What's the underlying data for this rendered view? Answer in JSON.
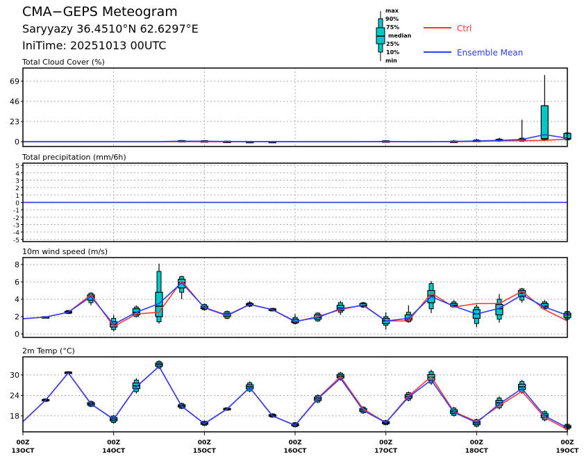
{
  "header": {
    "title": "CMA−GEPS Meteogram",
    "station": "Saryyazy 36.4510°N 62.6297°E",
    "init_time": "IniTime: 20251013 00UTC"
  },
  "legend": {
    "box_labels": [
      "max",
      "90%",
      "75%",
      "median",
      "25%",
      "10%",
      "min"
    ],
    "ctrl_label": "Ctrl",
    "mean_label": "Ensemble Mean"
  },
  "colors": {
    "ctrl": "#ff3333",
    "mean": "#2a3cff",
    "box": "#00c8c8",
    "grid": "#aaaaaa"
  },
  "chart_data": [
    {
      "type": "line",
      "title": "Total Cloud Cover (%)",
      "ylim": [
        -5.5,
        84
      ],
      "yticks": [
        0,
        23,
        46,
        69
      ],
      "x_steps_hours": 6,
      "ensemble_mean": [
        0,
        0,
        0,
        0,
        0,
        0,
        0,
        0.6,
        0.5,
        0.2,
        0.1,
        0.1,
        0,
        0,
        0,
        0,
        0.3,
        0,
        0,
        0.3,
        0.8,
        1.5,
        2.5,
        8,
        4
      ],
      "ctrl": [
        0,
        0,
        0,
        0,
        0,
        0,
        0,
        0,
        0,
        0,
        0,
        0,
        0,
        0,
        0,
        0,
        0,
        0,
        0,
        0,
        0.3,
        1,
        1.2,
        1.5,
        3
      ],
      "boxes": [
        null,
        null,
        null,
        null,
        null,
        null,
        null,
        [
          0,
          0.2,
          0.4,
          0.8,
          1.2,
          1.4,
          1.6
        ],
        [
          0,
          0.2,
          0.4,
          0.7,
          1.0,
          1.2,
          1.4
        ],
        [
          0,
          0.1,
          0.2,
          0.3,
          0.5,
          0.6,
          0.7
        ],
        [
          0,
          0,
          0.1,
          0.2,
          0.3,
          0.4,
          0.5
        ],
        [
          0,
          0,
          0.1,
          0.2,
          0.3,
          0.4,
          0.5
        ],
        null,
        null,
        null,
        null,
        [
          0,
          0.2,
          0.4,
          0.6,
          0.9,
          1.1,
          1.3
        ],
        null,
        null,
        [
          0,
          0,
          0.2,
          0.4,
          0.6,
          0.8,
          2
        ],
        [
          0,
          0.3,
          0.6,
          1,
          1.5,
          2,
          3
        ],
        [
          0,
          0.5,
          1,
          1.6,
          2.5,
          3,
          4.5
        ],
        [
          0,
          0.5,
          1,
          2,
          3,
          4,
          25
        ],
        [
          1,
          2,
          3,
          3.5,
          41,
          41,
          76
        ],
        [
          1,
          2,
          3,
          3.5,
          9.5,
          10,
          10
        ]
      ]
    },
    {
      "type": "line",
      "title": "Total precipitation (mm/6h)",
      "ylim": [
        -5.3,
        5.3
      ],
      "yticks": [
        -5,
        -4,
        -3,
        -2,
        -1,
        0,
        1,
        2,
        3,
        4,
        5
      ],
      "ensemble_mean": [
        0,
        0,
        0,
        0,
        0,
        0,
        0,
        0,
        0,
        0,
        0,
        0,
        0,
        0,
        0,
        0,
        0,
        0,
        0,
        0,
        0,
        0,
        0,
        0,
        0
      ],
      "ctrl": [
        0,
        0,
        0,
        0,
        0,
        0,
        0,
        0,
        0,
        0,
        0,
        0,
        0,
        0,
        0,
        0,
        0,
        0,
        0,
        0,
        0,
        0,
        0,
        0,
        0
      ],
      "boxes": []
    },
    {
      "type": "line",
      "title": "10m wind speed (m/s)",
      "ylim": [
        -0.4,
        8.8
      ],
      "yticks": [
        0,
        2,
        4,
        6,
        8
      ],
      "ensemble_mean": [
        1.75,
        1.95,
        2.5,
        4.3,
        1.1,
        2.5,
        3.5,
        5.9,
        3.05,
        2.15,
        3.4,
        2.8,
        1.45,
        1.9,
        2.9,
        3.3,
        1.5,
        1.8,
        4.3,
        3.2,
        2.3,
        2.95,
        4.5,
        3.1,
        2.15
      ],
      "ctrl": [
        1.75,
        1.95,
        2.5,
        4.5,
        0.85,
        2.3,
        2.5,
        6.1,
        3.0,
        2.1,
        3.4,
        2.8,
        1.4,
        2.0,
        2.8,
        3.35,
        1.5,
        1.5,
        4.7,
        3.1,
        3.5,
        3.5,
        4.9,
        2.8,
        1.5
      ],
      "boxes": [
        null,
        [
          1.85,
          1.9,
          1.92,
          1.95,
          1.98,
          2.0,
          2.05
        ],
        [
          2.3,
          2.35,
          2.4,
          2.5,
          2.6,
          2.7,
          2.75
        ],
        [
          3.3,
          3.6,
          3.9,
          4.3,
          4.5,
          4.7,
          4.8
        ],
        [
          0.3,
          0.5,
          0.8,
          1.1,
          1.4,
          1.8,
          2.2
        ],
        [
          1.9,
          2.0,
          2.2,
          2.5,
          2.9,
          3.1,
          3.3
        ],
        [
          1.2,
          1.4,
          2.0,
          3.2,
          4.8,
          7.2,
          8.1
        ],
        [
          4.0,
          4.8,
          5.3,
          5.9,
          6.3,
          6.6,
          6.7
        ],
        [
          2.7,
          2.8,
          2.9,
          3.0,
          3.2,
          3.4,
          3.5
        ],
        [
          1.7,
          1.8,
          2.0,
          2.2,
          2.4,
          2.6,
          2.7
        ],
        [
          3.1,
          3.2,
          3.3,
          3.4,
          3.5,
          3.6,
          3.8
        ],
        [
          2.6,
          2.65,
          2.7,
          2.8,
          2.9,
          2.95,
          3.0
        ],
        [
          1.1,
          1.2,
          1.3,
          1.45,
          1.7,
          1.9,
          2.3
        ],
        [
          1.4,
          1.5,
          1.7,
          1.9,
          2.2,
          2.4,
          2.5
        ],
        [
          2.2,
          2.5,
          2.7,
          3.0,
          3.3,
          3.6,
          3.8
        ],
        [
          3.0,
          3.1,
          3.2,
          3.3,
          3.5,
          3.6,
          3.7
        ],
        [
          0.5,
          1.0,
          1.2,
          1.5,
          1.8,
          2.0,
          2.5
        ],
        [
          1.3,
          1.4,
          1.6,
          1.8,
          2.2,
          2.5,
          3.3
        ],
        [
          2.4,
          2.9,
          3.6,
          4.4,
          5.0,
          5.8,
          6.1
        ],
        [
          3.0,
          3.1,
          3.2,
          3.3,
          3.5,
          3.7,
          3.9
        ],
        [
          0.8,
          1.2,
          1.8,
          2.3,
          2.8,
          3.1,
          3.4
        ],
        [
          1.3,
          1.7,
          2.2,
          2.9,
          3.4,
          4.0,
          4.6
        ],
        [
          3.6,
          3.9,
          4.3,
          4.7,
          5.0,
          5.2,
          5.3
        ],
        [
          2.8,
          2.9,
          3.0,
          3.2,
          3.5,
          3.7,
          3.9
        ],
        [
          1.6,
          1.7,
          1.9,
          2.2,
          2.4,
          2.6,
          2.7
        ]
      ]
    },
    {
      "type": "line",
      "title": "2m Temp (°C)",
      "ylim": [
        13.3,
        35.3
      ],
      "yticks": [
        18,
        24,
        30
      ],
      "ensemble_mean": [
        16.3,
        22.6,
        30.6,
        21.5,
        17.0,
        26.5,
        32.5,
        20.8,
        15.7,
        20.0,
        26.3,
        18.0,
        15.2,
        23.0,
        29.0,
        19.6,
        16.0,
        23.5,
        28.5,
        19.0,
        16.0,
        21.5,
        26.0,
        18.0,
        14.5
      ],
      "ctrl": [
        16.3,
        22.6,
        30.6,
        21.5,
        17.0,
        26.5,
        32.5,
        20.8,
        15.7,
        20.0,
        26.3,
        18.0,
        15.2,
        23.2,
        29.5,
        20.0,
        16.0,
        23.8,
        29.5,
        19.2,
        16.3,
        21.0,
        25.2,
        17.5,
        14.0
      ],
      "box_median": [
        null,
        22.6,
        30.7,
        21.5,
        17.0,
        26.8,
        33.0,
        20.9,
        15.8,
        20.0,
        26.5,
        18.1,
        15.4,
        23.0,
        29.6,
        19.7,
        16.0,
        23.7,
        29.3,
        19.2,
        15.9,
        21.8,
        26.5,
        18.0,
        14.8
      ],
      "box_spread": [
        0,
        0.3,
        0.2,
        0.6,
        0.8,
        1.4,
        0.8,
        0.6,
        0.5,
        0.3,
        1.0,
        0.4,
        0.5,
        0.8,
        0.8,
        0.7,
        0.5,
        0.9,
        1.4,
        0.9,
        0.8,
        1.2,
        1.3,
        1.0,
        0.6
      ]
    }
  ],
  "x_axis": {
    "ticks": [
      {
        "step": 0,
        "time": "00Z",
        "date": "13OCT"
      },
      {
        "step": 4,
        "time": "00Z",
        "date": "14OCT"
      },
      {
        "step": 8,
        "time": "00Z",
        "date": "15OCT"
      },
      {
        "step": 12,
        "time": "00Z",
        "date": "16OCT"
      },
      {
        "step": 16,
        "time": "00Z",
        "date": "17OCT"
      },
      {
        "step": 20,
        "time": "00Z",
        "date": "18OCT"
      },
      {
        "step": 24,
        "time": "00Z",
        "date": "19OCT"
      }
    ]
  }
}
